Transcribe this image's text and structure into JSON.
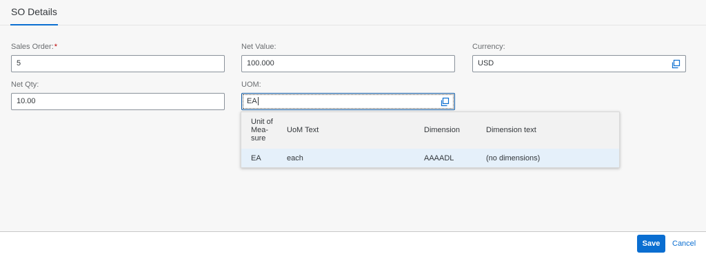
{
  "tab": {
    "label": "SO Details"
  },
  "form": {
    "sales_order": {
      "label": "Sales Order:",
      "required_mark": "*",
      "value": "5"
    },
    "net_value": {
      "label": "Net Value:",
      "value": "100.000"
    },
    "currency": {
      "label": "Currency:",
      "value": "USD"
    },
    "net_qty": {
      "label": "Net Qty:",
      "value": "10.00"
    },
    "uom": {
      "label": "UOM:",
      "value": "EA"
    }
  },
  "suggestions": {
    "columns": {
      "unit_line1": "Unit of",
      "unit_line2": "Mea-",
      "unit_line3": "sure",
      "uom_text": "UoM Text",
      "dimension": "Dimension",
      "dimension_text": "Dimension text"
    },
    "rows": [
      {
        "unit": "EA",
        "uom_text": "each",
        "dimension": "AAAADL",
        "dimension_text": "(no dimensions)"
      }
    ]
  },
  "footer": {
    "save_label": "Save",
    "cancel_label": "Cancel"
  },
  "colors": {
    "accent": "#0a6ed1",
    "required": "#bb0000",
    "selected_row": "#e5f0fa"
  },
  "icons": {
    "value_help": "value-help-icon"
  }
}
